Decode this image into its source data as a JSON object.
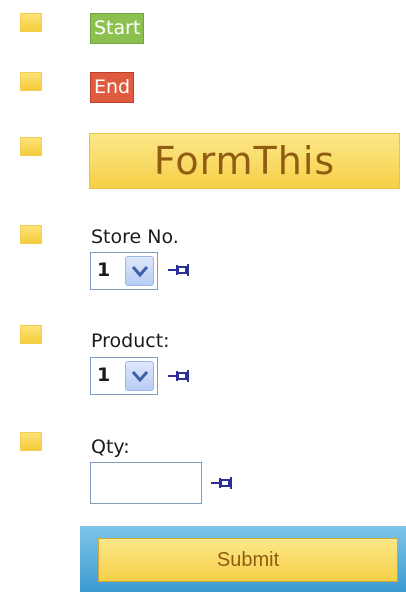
{
  "markers": {
    "start_label": "Start",
    "end_label": "End"
  },
  "form": {
    "title": "FormThis",
    "fields": [
      {
        "label": "Store No.",
        "type": "select",
        "value": "1",
        "pin_icon": "pin-icon"
      },
      {
        "label": "Product:",
        "type": "select",
        "value": "1",
        "pin_icon": "pin-icon"
      },
      {
        "label": "Qty:",
        "type": "text",
        "value": "",
        "pin_icon": "pin-icon"
      }
    ],
    "submit_label": "Submit"
  },
  "colors": {
    "start_tag": "#8cc152",
    "end_tag": "#e05a3f",
    "title_bar": "#f6cf47",
    "submit_panel": "#3d9bd0"
  }
}
